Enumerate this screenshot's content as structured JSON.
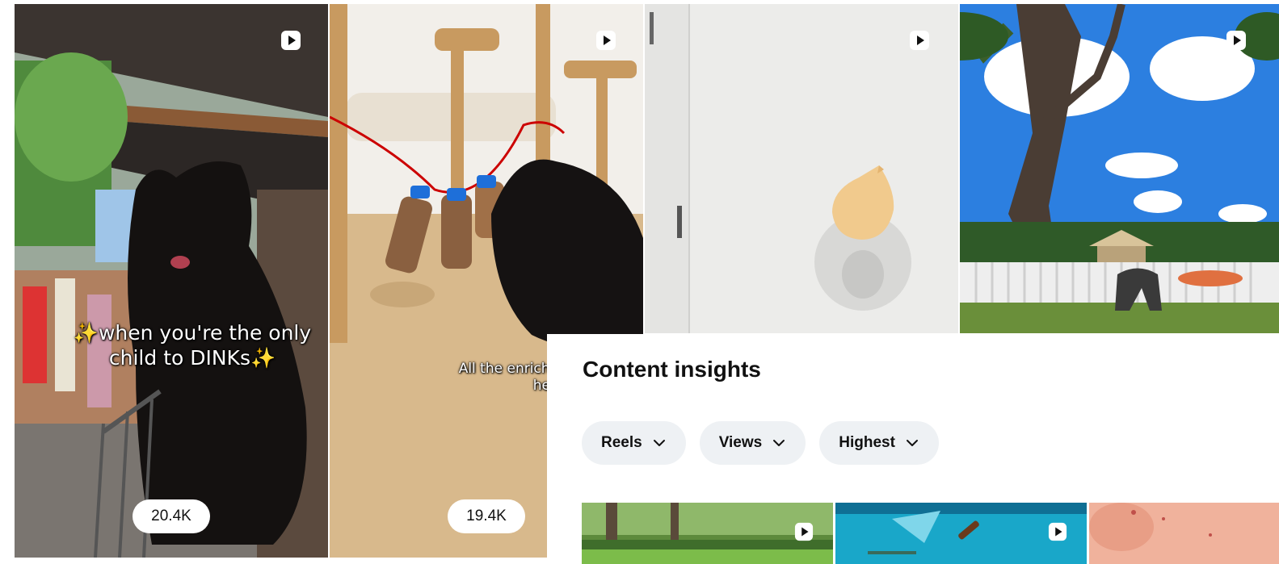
{
  "reels": [
    {
      "caption_line1": "✨when you're the only",
      "caption_line2": "child to DINKs✨",
      "views": "20.4K",
      "icon": "reel-play-icon"
    },
    {
      "caption_line1": "All the enrichment toys an",
      "caption_line2": "her favourite 😅",
      "views": "19.4K",
      "icon": "reel-play-icon"
    },
    {
      "icon": "reel-play-icon"
    },
    {
      "icon": "reel-play-icon"
    }
  ],
  "insights": {
    "title": "Content insights",
    "filters": [
      {
        "label": "Reels",
        "icon": "chevron-down-icon"
      },
      {
        "label": "Views",
        "icon": "chevron-down-icon"
      },
      {
        "label": "Highest",
        "icon": "chevron-down-icon"
      }
    ]
  },
  "colors": {
    "pill_bg": "#eef1f4",
    "text": "#111111"
  }
}
